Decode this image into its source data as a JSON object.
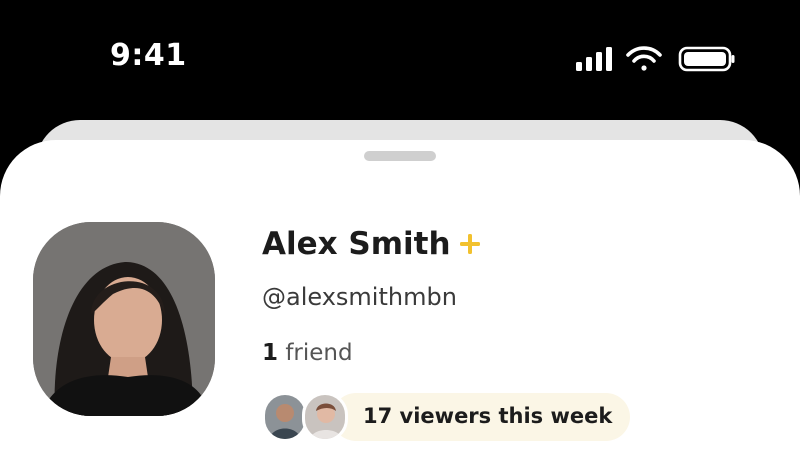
{
  "status_bar": {
    "time": "9:41",
    "icons": [
      "signal-icon",
      "wifi-icon",
      "battery-icon"
    ]
  },
  "profile": {
    "name": "Alex Smith",
    "badge_icon": "plus-icon",
    "badge_color": "#F2C12E",
    "handle": "@alexsmithmbn",
    "friends_count": "1",
    "friends_label": "friend",
    "viewers_text": "17 viewers this week",
    "viewer_avatars": [
      "viewer-avatar-1",
      "viewer-avatar-2"
    ]
  },
  "colors": {
    "background": "#000000",
    "sheet": "#FFFFFF",
    "pill": "#FBF6E6",
    "text": "#1C1C1C"
  }
}
